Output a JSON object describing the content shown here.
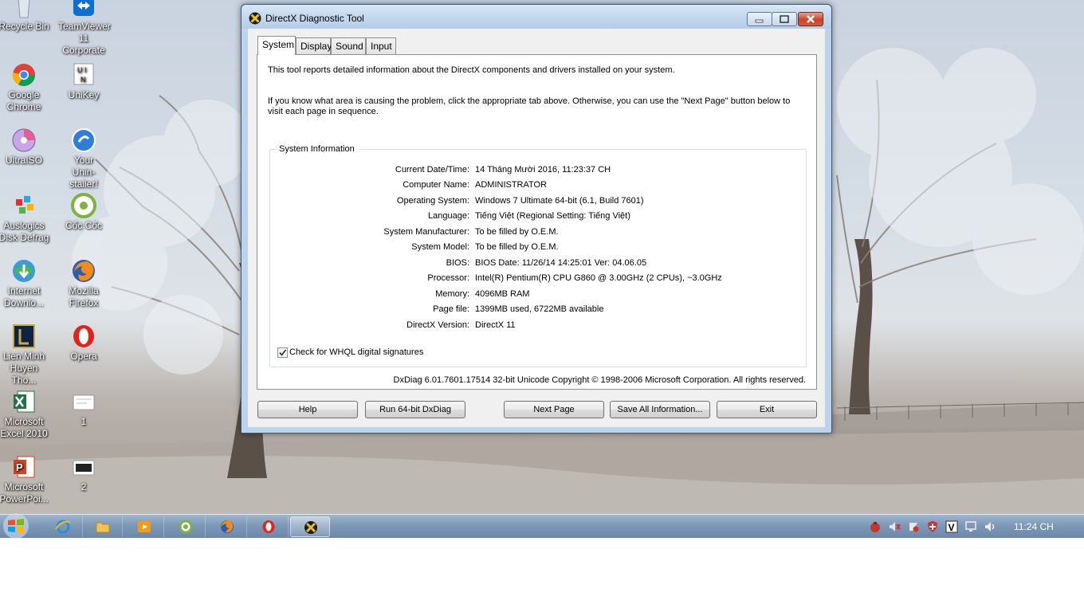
{
  "desktop": {
    "icons": [
      {
        "label": "Recycle Bin",
        "icon": "recycle-bin-icon"
      },
      {
        "label": "TeamViewer\n11 Corporate",
        "icon": "teamviewer-icon"
      },
      {
        "label": "Google\nChrome",
        "icon": "chrome-icon"
      },
      {
        "label": "UniKey",
        "icon": "unikey-icon"
      },
      {
        "label": "UltraISO",
        "icon": "ultraiso-icon"
      },
      {
        "label": "Your\nUnin-staller!",
        "icon": "uninstaller-icon"
      },
      {
        "label": "Auslogics\nDisk Defrag",
        "icon": "disk-defrag-icon"
      },
      {
        "label": "Cốc Cốc",
        "icon": "coccoc-icon"
      },
      {
        "label": "Internet\nDownlo...",
        "icon": "idm-icon"
      },
      {
        "label": "Mozilla\nFirefox",
        "icon": "firefox-icon"
      },
      {
        "label": "Lien Minh\nHuyen Tho...",
        "icon": "lmht-icon"
      },
      {
        "label": "Opera",
        "icon": "opera-icon"
      },
      {
        "label": "Microsoft\nExcel 2010",
        "icon": "excel-icon"
      },
      {
        "label": "1",
        "icon": "file-icon"
      },
      {
        "label": "Microsoft\nPowerPoi...",
        "icon": "powerpoint-icon"
      },
      {
        "label": "2",
        "icon": "file-icon"
      }
    ]
  },
  "window": {
    "title": "DirectX Diagnostic Tool",
    "tabs": [
      "System",
      "Display",
      "Sound",
      "Input"
    ],
    "intro1": "This tool reports detailed information about the DirectX components and drivers installed on your system.",
    "intro2": "If you know what area is causing the problem, click the appropriate tab above.  Otherwise, you can use the \"Next Page\" button below to visit each page in sequence.",
    "group_title": "System Information",
    "rows": [
      {
        "label": "Current Date/Time:",
        "value": "14 Tháng Mười 2016, 11:23:37 CH"
      },
      {
        "label": "Computer Name:",
        "value": "ADMINISTRATOR"
      },
      {
        "label": "Operating System:",
        "value": "Windows 7 Ultimate 64-bit (6.1, Build 7601)"
      },
      {
        "label": "Language:",
        "value": "Tiếng Việt (Regional Setting: Tiếng Việt)"
      },
      {
        "label": "System Manufacturer:",
        "value": "To be filled by O.E.M."
      },
      {
        "label": "System Model:",
        "value": "To be filled by O.E.M."
      },
      {
        "label": "BIOS:",
        "value": "BIOS Date: 11/26/14 14:25:01 Ver: 04.06.05"
      },
      {
        "label": "Processor:",
        "value": "Intel(R) Pentium(R) CPU G860 @ 3.00GHz (2 CPUs), ~3.0GHz"
      },
      {
        "label": "Memory:",
        "value": "4096MB RAM"
      },
      {
        "label": "Page file:",
        "value": "1399MB used, 6722MB available"
      },
      {
        "label": "DirectX Version:",
        "value": "DirectX 11"
      }
    ],
    "whql_label": "Check for WHQL digital signatures",
    "whql_checked": true,
    "copyright": "DxDiag 6.01.7601.17514 32-bit Unicode  Copyright © 1998-2006 Microsoft Corporation.  All rights reserved.",
    "buttons": {
      "help": "Help",
      "run64": "Run 64-bit DxDiag",
      "next": "Next Page",
      "save": "Save All Information...",
      "exit": "Exit"
    }
  },
  "taskbar": {
    "items": [
      "internet-explorer-icon",
      "file-explorer-icon",
      "media-player-icon",
      "coccoc-icon",
      "firefox-icon",
      "opera-icon",
      "directx-icon"
    ],
    "clock": "11:24 CH"
  }
}
